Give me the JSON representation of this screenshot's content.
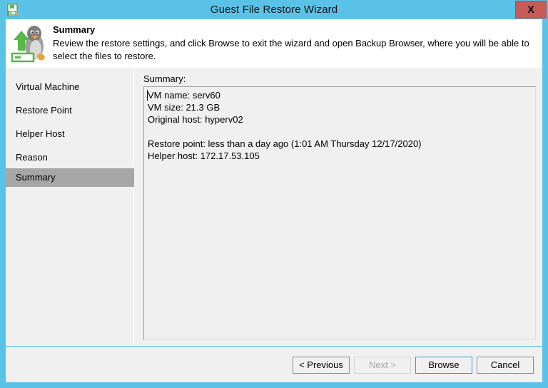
{
  "window": {
    "title": "Guest File Restore Wizard",
    "title_icon": "wizard-document-icon",
    "close_label": "X",
    "accent_color": "#5bc2e7"
  },
  "header": {
    "icon": "linux-penguin-restore-icon",
    "title": "Summary",
    "description": "Review the restore settings, and click Browse to exit the wizard and open Backup Browser, where you will be able to select the files to restore."
  },
  "sidebar": {
    "items": [
      {
        "label": "Virtual Machine",
        "selected": false
      },
      {
        "label": "Restore Point",
        "selected": false
      },
      {
        "label": "Helper Host",
        "selected": false
      },
      {
        "label": "Reason",
        "selected": false
      },
      {
        "label": "Summary",
        "selected": true
      }
    ],
    "selected_color": "#a6a6a6"
  },
  "content": {
    "summary_label": "Summary:",
    "summary_text": "VM name: serv60\nVM size: 21.3 GB\nOriginal host: hyperv02\n\nRestore point: less than a day ago (1:01 AM Thursday 12/17/2020)\nHelper host: 172.17.53.105",
    "details": {
      "vm_name": "serv60",
      "vm_size": "21.3 GB",
      "original_host": "hyperv02",
      "restore_point": "less than a day ago (1:01 AM Thursday 12/17/2020)",
      "helper_host": "172.17.53.105"
    }
  },
  "footer": {
    "buttons": [
      {
        "label": "< Previous",
        "state": "enabled"
      },
      {
        "label": "Next >",
        "state": "disabled"
      },
      {
        "label": "Browse",
        "state": "focused"
      },
      {
        "label": "Cancel",
        "state": "enabled"
      }
    ]
  }
}
